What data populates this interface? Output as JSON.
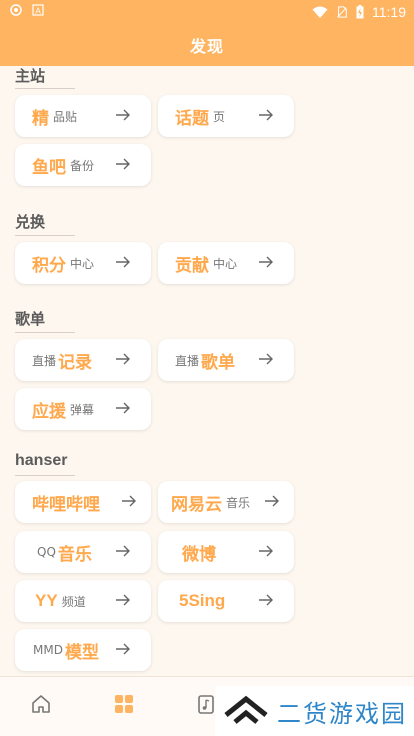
{
  "status_bar": {
    "time": "11:19",
    "icons": [
      "notification-icon",
      "app-a-icon",
      "wifi-icon",
      "no-sim-icon",
      "battery-charging-icon"
    ]
  },
  "header": {
    "title": "发现"
  },
  "sections": [
    {
      "title": "主站",
      "items": [
        {
          "main": "精",
          "sub": "品贴"
        },
        {
          "main": "话题",
          "sub": "页"
        },
        {
          "main": "鱼吧",
          "sub": "备份"
        }
      ]
    },
    {
      "title": "兑换",
      "items": [
        {
          "main": "积分",
          "sub": "中心"
        },
        {
          "main": "贡献",
          "sub": "中心"
        }
      ]
    },
    {
      "title": "歌单",
      "items": [
        {
          "pre": "直播",
          "main": "记录"
        },
        {
          "pre": "直播",
          "main": "歌单"
        },
        {
          "main": "应援",
          "sub": "弹幕"
        }
      ]
    },
    {
      "title": "hanser",
      "items": [
        {
          "main": "哔哩哔哩"
        },
        {
          "main": "网易云",
          "sub": "音乐"
        },
        {
          "pre": "QQ",
          "main": "音乐"
        },
        {
          "main": "微博"
        },
        {
          "main": "YY",
          "sub": "频道"
        },
        {
          "main": "5Sing"
        },
        {
          "pre": "MMD",
          "main": "模型"
        }
      ]
    }
  ],
  "bottom_nav": {
    "items": [
      "home-icon",
      "discover-grid-icon",
      "music-icon"
    ],
    "active": "discover-grid-icon"
  },
  "watermark": {
    "text": "二货游戏园"
  },
  "colors": {
    "accent": "#ffb462",
    "chip_text": "#ffa84c",
    "background": "#fdf7f0"
  }
}
